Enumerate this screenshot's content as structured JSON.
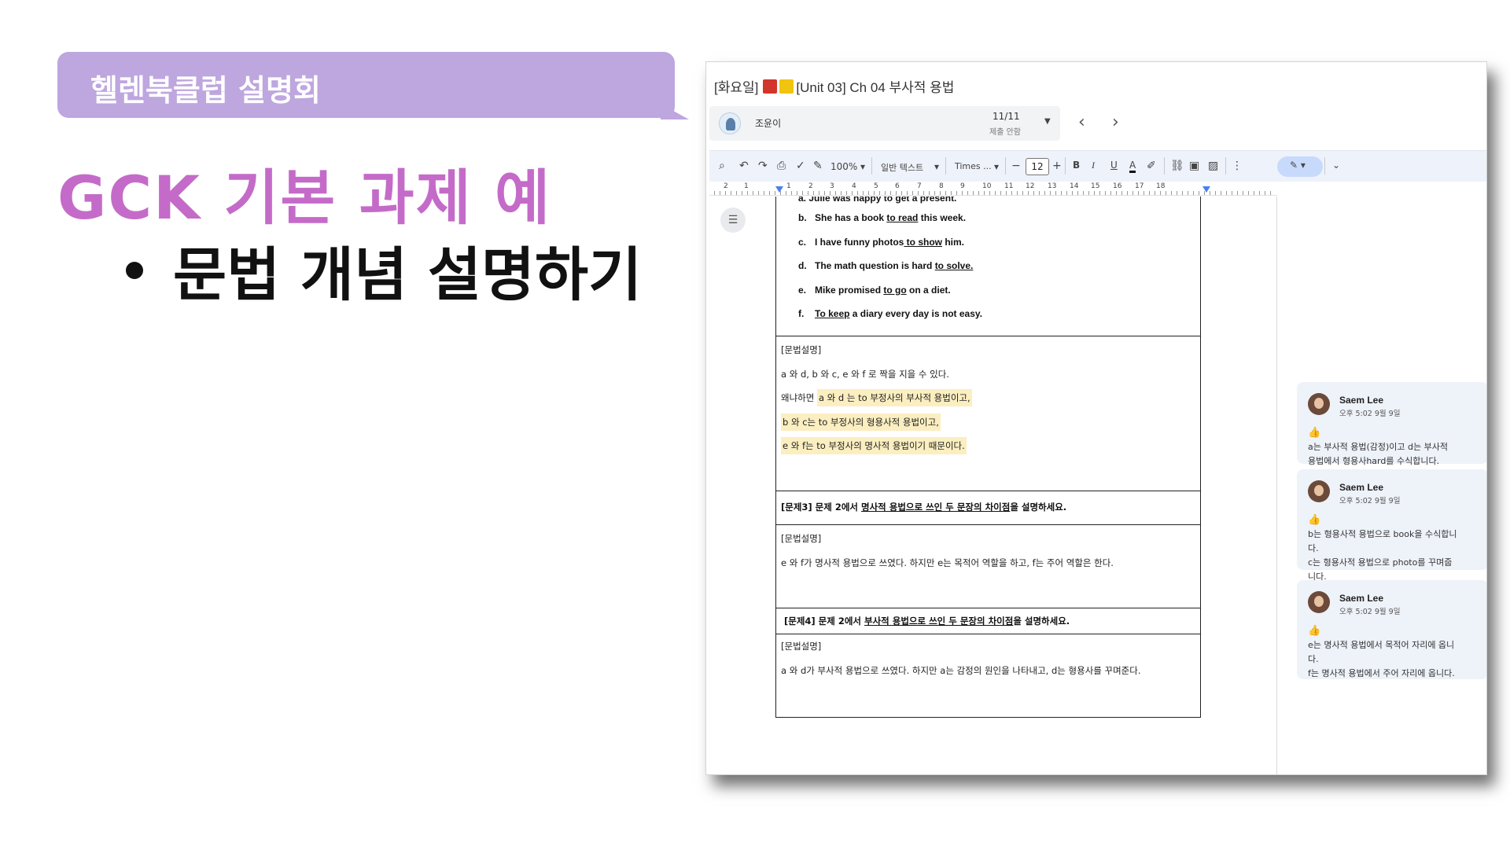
{
  "slide": {
    "banner": "헬렌북클럽 설명회",
    "title": "GCK 기본 과제 예",
    "bullet": "문법 개념 설명하기"
  },
  "doc": {
    "title_prefix": "[화요일]",
    "title": "[Unit 03] Ch 04 부사적 용법",
    "title_colors": [
      "#d2352b",
      "#f1c40f"
    ]
  },
  "student": {
    "name": "조윤이",
    "count": "11/11",
    "status": "제출 안함"
  },
  "toolbar": {
    "zoom": "100%",
    "style": "일반 텍스트",
    "font": "Times ...",
    "font_size": "12",
    "bold": "B",
    "italic": "I",
    "underline": "U",
    "text_color": "A"
  },
  "ruler": [
    "2",
    "1",
    "",
    "1",
    "2",
    "3",
    "4",
    "5",
    "6",
    "7",
    "8",
    "9",
    "10",
    "11",
    "12",
    "13",
    "14",
    "15",
    "16",
    "17",
    "18"
  ],
  "examples": {
    "cut": "a.   Julie was happy to get a present.",
    "items": [
      {
        "label": "b.",
        "pre": "She has a book ",
        "u": "to read",
        "post": " this week."
      },
      {
        "label": "c.",
        "pre": "I have funny photos",
        "u": " to show",
        "post": " him."
      },
      {
        "label": "d.",
        "pre": "The math question is hard ",
        "u": "to solve.",
        "post": ""
      },
      {
        "label": "e.",
        "pre": "Mike promised ",
        "u": "to go",
        "post": " on a diet."
      },
      {
        "label": "f.",
        "pre": "",
        "u": "To keep",
        "post": " a diary every day is not easy."
      }
    ]
  },
  "explain1": {
    "head": "[문법설명]",
    "line1": "a 와 d, b 와 c, e 와 f 로 짝을 지을 수 있다.",
    "line2_pre": "왜냐하면 ",
    "line2_hl": "a 와 d 는 to 부정사의 부사적 용법이고,",
    "line3": "b 와 c는 to 부정사의 형용사적 용법이고,",
    "line4": "e 와 f는 to 부정사의 명사적 용법이기 때문이다."
  },
  "q3": {
    "pre": "[문제3] 문제 2에서 ",
    "u": "명사적 용법으로 쓰인 두 문장의 차이점",
    "post": "을 설명하세요."
  },
  "explain2": {
    "head": "[문법설명]",
    "line1": "e 와 f가 명사적 용법으로 쓰였다. 하지만 e는 목적어 역할을 하고, f는 주어 역할은 한다."
  },
  "q4": {
    "pre": "[문제4] 문제 2에서 ",
    "u": "부사적 용법으로 쓰인 두 문장의 차이점",
    "post": "을 설명하세요."
  },
  "explain3": {
    "head": "[문법설명]",
    "line1": "a 와 d가 부사적 용법으로 쓰였다. 하지만 a는 감정의 원인을 나타내고, d는 형용사를 꾸며준다."
  },
  "comments": [
    {
      "name": "Saem Lee",
      "time": "오후 5:02 9월 9일",
      "thumb": "👍",
      "lines": [
        "a는 부사적 용법(감정)이고 d는 부사적",
        "용법에서 형용사hard를 수식합니다."
      ]
    },
    {
      "name": "Saem Lee",
      "time": "오후 5:02 9월 9일",
      "thumb": "👍",
      "lines": [
        "b는 형용사적 용법으로 book을 수식합니",
        "다.",
        "c는 형용사적 용법으로 photo를 꾸며줍",
        "니다."
      ]
    },
    {
      "name": "Saem Lee",
      "time": "오후 5:02 9월 9일",
      "thumb": "👍",
      "lines": [
        "e는 명사적 용법에서 목적어 자리에 옵니",
        "다.",
        "f는 명사적 용법에서 주어 자리에 옵니다."
      ]
    }
  ]
}
